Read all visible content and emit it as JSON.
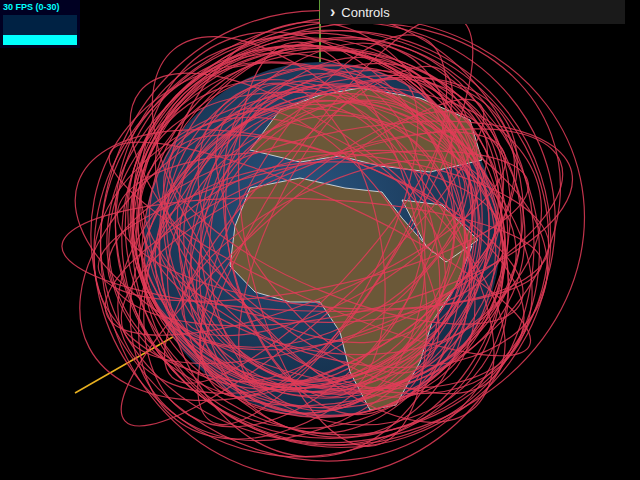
{
  "stats": {
    "label": "30 FPS (0-30)",
    "level": 0.35
  },
  "controls": {
    "icon": "›",
    "label": "Controls",
    "expanded": false
  }
}
